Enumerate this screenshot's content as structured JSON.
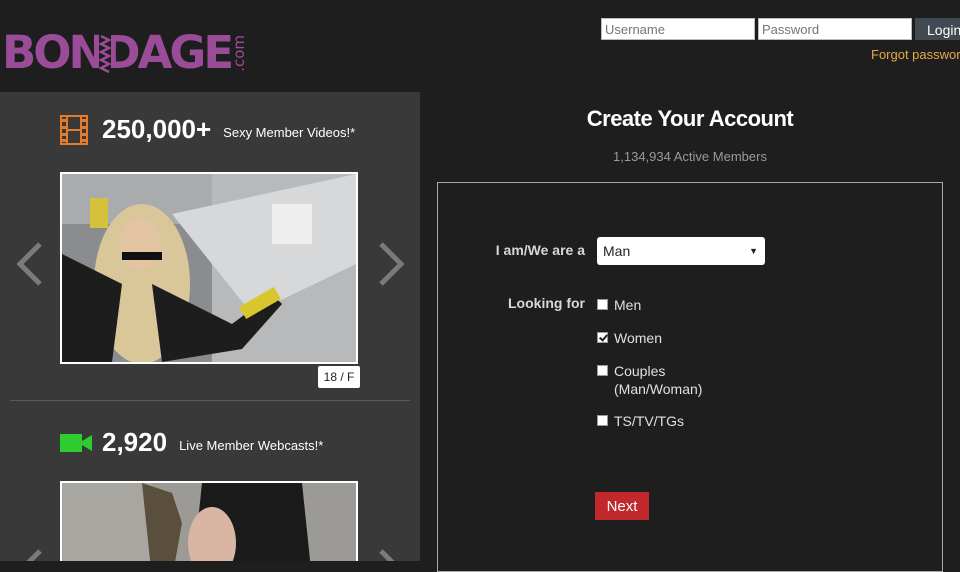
{
  "brand": {
    "name": "BONDAGE",
    "tld": ".com",
    "color": "#9b4c99"
  },
  "header": {
    "username_placeholder": "Username",
    "password_placeholder": "Password",
    "login_label": "Login",
    "forgot_label": "Forgot password"
  },
  "promo": {
    "videos": {
      "count": "250,000+",
      "label": "Sexy Member Videos!*",
      "icon": "film-icon"
    },
    "thumb_badge": "18 / F",
    "webcasts": {
      "count": "2,920",
      "label": "Live Member Webcasts!*",
      "icon": "camera-icon"
    }
  },
  "signup": {
    "title": "Create Your Account",
    "subtitle": "1,134,934 Active Members",
    "iam_label": "I am/We are a",
    "iam_value": "Man",
    "looking_label": "Looking for",
    "options": [
      {
        "label": "Men",
        "checked": false
      },
      {
        "label": "Women",
        "checked": true
      },
      {
        "label": "Couples",
        "label2": "(Man/Woman)",
        "checked": false
      },
      {
        "label": "TS/TV/TGs",
        "checked": false
      }
    ],
    "next_label": "Next",
    "next_color": "#c0282b"
  }
}
